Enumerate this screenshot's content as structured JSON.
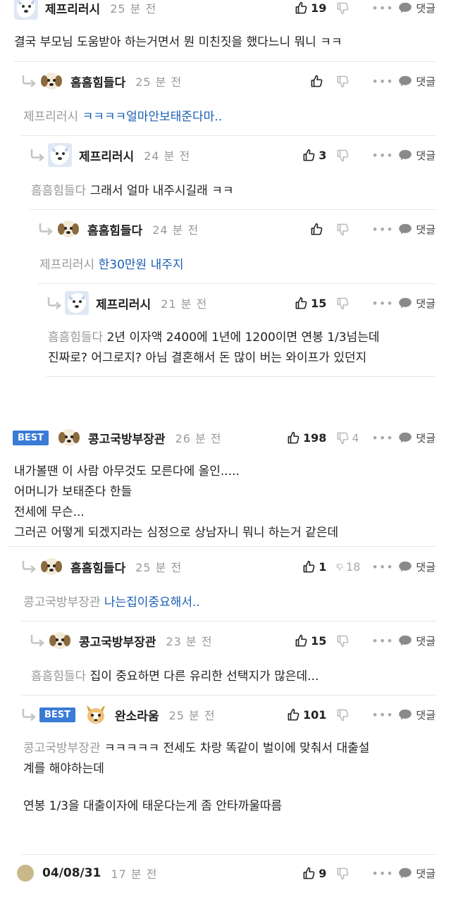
{
  "ui": {
    "like_count_empty": "",
    "dislike_empty": "",
    "more": "•••",
    "reply_label": "댓글"
  },
  "comments": [
    {
      "nick": "제프리러시",
      "time": "25 분 전",
      "likes": "19",
      "dislikes": "",
      "text": "결국 부모님 도움받아 하는거면서 뭔 미친짓을 했다느니 뭐니 ㅋㅋ"
    },
    {
      "nick": "흠흠힘들다",
      "time": "25 분 전",
      "likes": "",
      "dislikes": "",
      "mention": "제프리러시",
      "text": "ㅋㅋㅋㅋ얼마안보태준다마.."
    },
    {
      "nick": "제프리러시",
      "time": "24 분 전",
      "likes": "3",
      "dislikes": "",
      "mention": "흠흠힘들다",
      "text": "그래서 얼마 내주시길래 ㅋㅋ"
    },
    {
      "nick": "흠흠힘들다",
      "time": "24 분 전",
      "likes": "",
      "dislikes": "",
      "mention": "제프리러시",
      "text": "한30만원 내주지"
    },
    {
      "nick": "제프리러시",
      "time": "21 분 전",
      "likes": "15",
      "dislikes": "",
      "mention": "흠흠힘들다",
      "text_line1": "2년 이자액 2400에 1년에 1200이면 연봉 1/3넘는데",
      "text_line2": "진짜로? 어그로지? 아님 결혼해서 돈 많이 버는 와이프가 있던지"
    },
    {
      "best": "BEST",
      "nick": "콩고국방부장관",
      "time": "26 분 전",
      "likes": "198",
      "dislikes": "4",
      "lines": [
        "내가볼땐 이 사람 아무것도 모른다에 올인.....",
        "어머니가 보태준다 한들",
        "전세에 무슨...",
        "그러곤 어떻게 되겠지라는 심정으로 상남자니 뭐니 하는거 같은데"
      ]
    },
    {
      "nick": "흠흠힘들다",
      "time": "25 분 전",
      "likes": "1",
      "dislikes": "18",
      "mention": "콩고국방부장관",
      "text": "나는집이중요해서.."
    },
    {
      "nick": "콩고국방부장관",
      "time": "23 분 전",
      "likes": "15",
      "dislikes": "",
      "mention": "흠흠힘들다",
      "text": "집이 중요하면 다른 유리한 선택지가 많은데..."
    },
    {
      "best": "BEST",
      "nick": "완소라움",
      "time": "25 분 전",
      "likes": "101",
      "dislikes": "",
      "mention": "콩고국방부장관",
      "text_line1": "ㅋㅋㅋㅋㅋ 전세도 차랑 똑같이 벌이에 맞춰서 대출설",
      "text_line2": "계를 해야하는데",
      "text_line3": "연봉 1/3을 대출이자에 태운다는게 좀 안타까울따름"
    },
    {
      "nick": "04/08/31",
      "time": "17 분 전",
      "likes": "9",
      "dislikes": ""
    }
  ],
  "colors": {
    "link": "#1a5fb4",
    "best_badge": "#3a7bd5",
    "mention": "#999999"
  }
}
